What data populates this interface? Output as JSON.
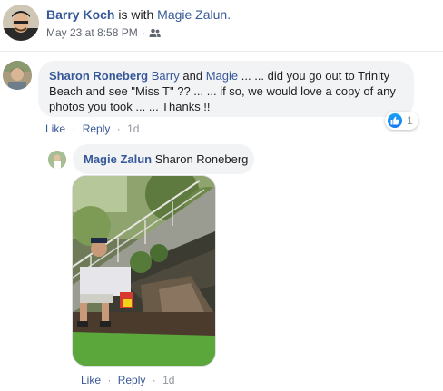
{
  "post": {
    "author": "Barry Koch",
    "with_text": "is with",
    "tagged": "Magie Zalun.",
    "timestamp": "May 23 at 8:58 PM",
    "separator": "·",
    "audience_icon": "friends-icon"
  },
  "comment": {
    "author": "Sharon Roneberg",
    "mention_1": "Barry",
    "and_text": "and",
    "mention_2": "Magie",
    "text": "... ... did you go out to Trinity Beach and see \"Miss T\" ?? ... ... if so, we would love a copy of any photos you took ... ... Thanks !!",
    "reaction_icon": "like-icon",
    "reaction_count": "1",
    "actions": {
      "like": "Like",
      "reply": "Reply",
      "dot": "·",
      "time": "1d"
    }
  },
  "reply": {
    "author": "Magie Zalun",
    "mention": "Sharon Roneberg",
    "actions": {
      "like": "Like",
      "reply": "Reply",
      "dot": "·",
      "time": "1d"
    }
  },
  "colors": {
    "link": "#365899",
    "text": "#1c1e21",
    "meta": "#616770",
    "bubble": "#f2f3f5",
    "like_blue": "#1877f2"
  }
}
